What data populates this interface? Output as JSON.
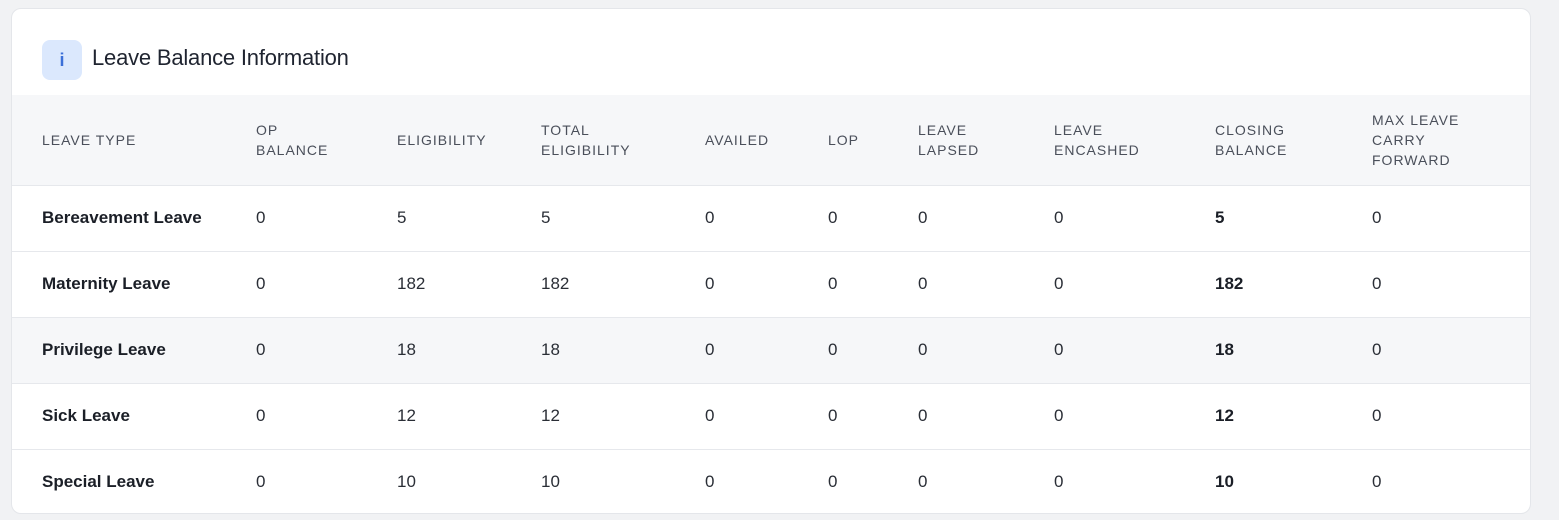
{
  "header": {
    "icon_glyph": "i",
    "icon_name": "info-icon",
    "title": "Leave Balance Information"
  },
  "table": {
    "columns": [
      [
        "LEAVE TYPE"
      ],
      [
        "OP",
        "BALANCE"
      ],
      [
        "ELIGIBILITY"
      ],
      [
        "TOTAL",
        "ELIGIBILITY"
      ],
      [
        "AVAILED"
      ],
      [
        "LOP"
      ],
      [
        "LEAVE",
        "LAPSED"
      ],
      [
        "LEAVE",
        "ENCASHED"
      ],
      [
        "CLOSING",
        "BALANCE"
      ],
      [
        "MAX LEAVE",
        "CARRY",
        "FORWARD"
      ]
    ],
    "rows": [
      [
        "Bereavement Leave",
        "0",
        "5",
        "5",
        "0",
        "0",
        "0",
        "0",
        "5",
        "0"
      ],
      [
        "Maternity Leave",
        "0",
        "182",
        "182",
        "0",
        "0",
        "0",
        "0",
        "182",
        "0"
      ],
      [
        "Privilege Leave",
        "0",
        "18",
        "18",
        "0",
        "0",
        "0",
        "0",
        "18",
        "0"
      ],
      [
        "Sick Leave",
        "0",
        "12",
        "12",
        "0",
        "0",
        "0",
        "0",
        "12",
        "0"
      ],
      [
        "Special Leave",
        "0",
        "10",
        "10",
        "0",
        "0",
        "0",
        "0",
        "10",
        "0"
      ]
    ],
    "highlighted_row_index": 2
  },
  "colors": {
    "accent": "#3b6fd8",
    "badge_bg": "#dbe8fd",
    "header_bg": "#f6f7f9"
  }
}
